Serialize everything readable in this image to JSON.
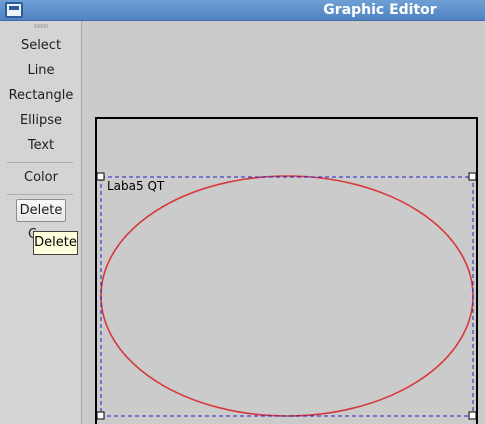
{
  "window": {
    "title": "Graphic Editor"
  },
  "toolbar": {
    "tools": [
      "Select",
      "Line",
      "Rectangle",
      "Ellipse",
      "Text"
    ],
    "color_label": "Color",
    "delete_label": "Delete",
    "partial_item": "C"
  },
  "tooltip": {
    "text": "Delete"
  },
  "scene": {
    "text_item": "Laba5 QT",
    "ellipse_stroke": "#d8393c",
    "selection_color": "#1f1fc8",
    "frame_color": "#000000"
  }
}
